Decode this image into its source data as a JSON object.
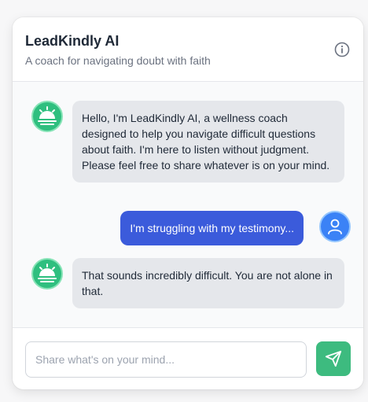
{
  "header": {
    "title": "LeadKindly AI",
    "subtitle": "A coach for navigating doubt with faith",
    "info_icon": "info-icon"
  },
  "messages": [
    {
      "sender": "bot",
      "avatar_icon": "bot-avatar-icon",
      "text": "Hello, I'm LeadKindly AI, a wellness coach designed to help you navigate difficult questions about faith. I'm here to listen without judgment. Please feel free to share whatever is on your mind."
    },
    {
      "sender": "user",
      "avatar_icon": "user-icon",
      "text": "I'm struggling with my testimony..."
    },
    {
      "sender": "bot",
      "avatar_icon": "bot-avatar-icon",
      "text": "That sounds incredibly difficult. You are not alone in that."
    }
  ],
  "composer": {
    "placeholder": "Share what's on your mind...",
    "value": "",
    "send_icon": "send-icon"
  },
  "colors": {
    "accent_green": "#3dbb7f",
    "user_bubble": "#3b5bdb",
    "bot_bubble": "#e5e7eb"
  }
}
